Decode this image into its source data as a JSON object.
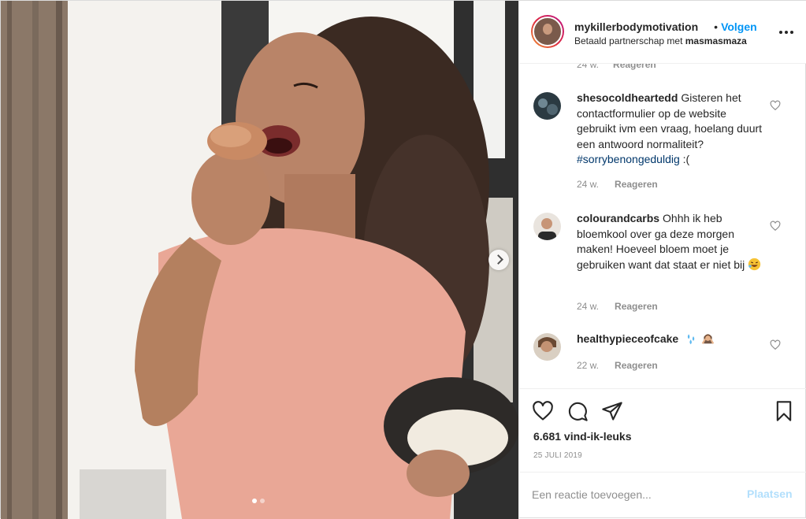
{
  "header": {
    "username": "mykillerbodymotivation",
    "bullet": "•",
    "follow_label": "Volgen",
    "partnership_prefix": "Betaald partnerschap met",
    "partner_name": "masmasmaza"
  },
  "comments": {
    "top_meta": {
      "time": "24 w.",
      "reply_label": "Reageren"
    },
    "items": [
      {
        "username": "shesocoldheartedd",
        "text": "Gisteren het contactformulier op de website gebruikt ivm een vraag, hoelang duurt een antwoord normaliteit?",
        "hashtag": "#sorrybenongeduldig",
        "suffix": ":(",
        "time": "24 w.",
        "reply_label": "Reageren"
      },
      {
        "username": "colourandcarbs",
        "text": "Ohhh ik heb bloemkool over ga deze morgen maken! Hoeveel bloem moet je gebruiken want dat staat er niet bij",
        "time": "24 w.",
        "reply_label": "Reageren"
      },
      {
        "username": "healthypieceofcake",
        "text": "",
        "time": "22 w.",
        "reply_label": "Reageren"
      }
    ]
  },
  "actions": {
    "likes": "6.681 vind-ik-leuks",
    "date": "25 JULI 2019"
  },
  "add_comment": {
    "placeholder": "Een reactie toevoegen...",
    "post_label": "Plaatsen"
  },
  "icons": {
    "heart": "heart-icon",
    "comment": "comment-icon",
    "share": "share-icon",
    "save": "bookmark-icon",
    "more": "more-options-icon",
    "verified": "verified-badge-icon"
  },
  "colors": {
    "link_blue": "#0095f6",
    "hashtag": "#00376b",
    "muted": "#8e8e8e",
    "post_disabled": "#b2dffc"
  }
}
